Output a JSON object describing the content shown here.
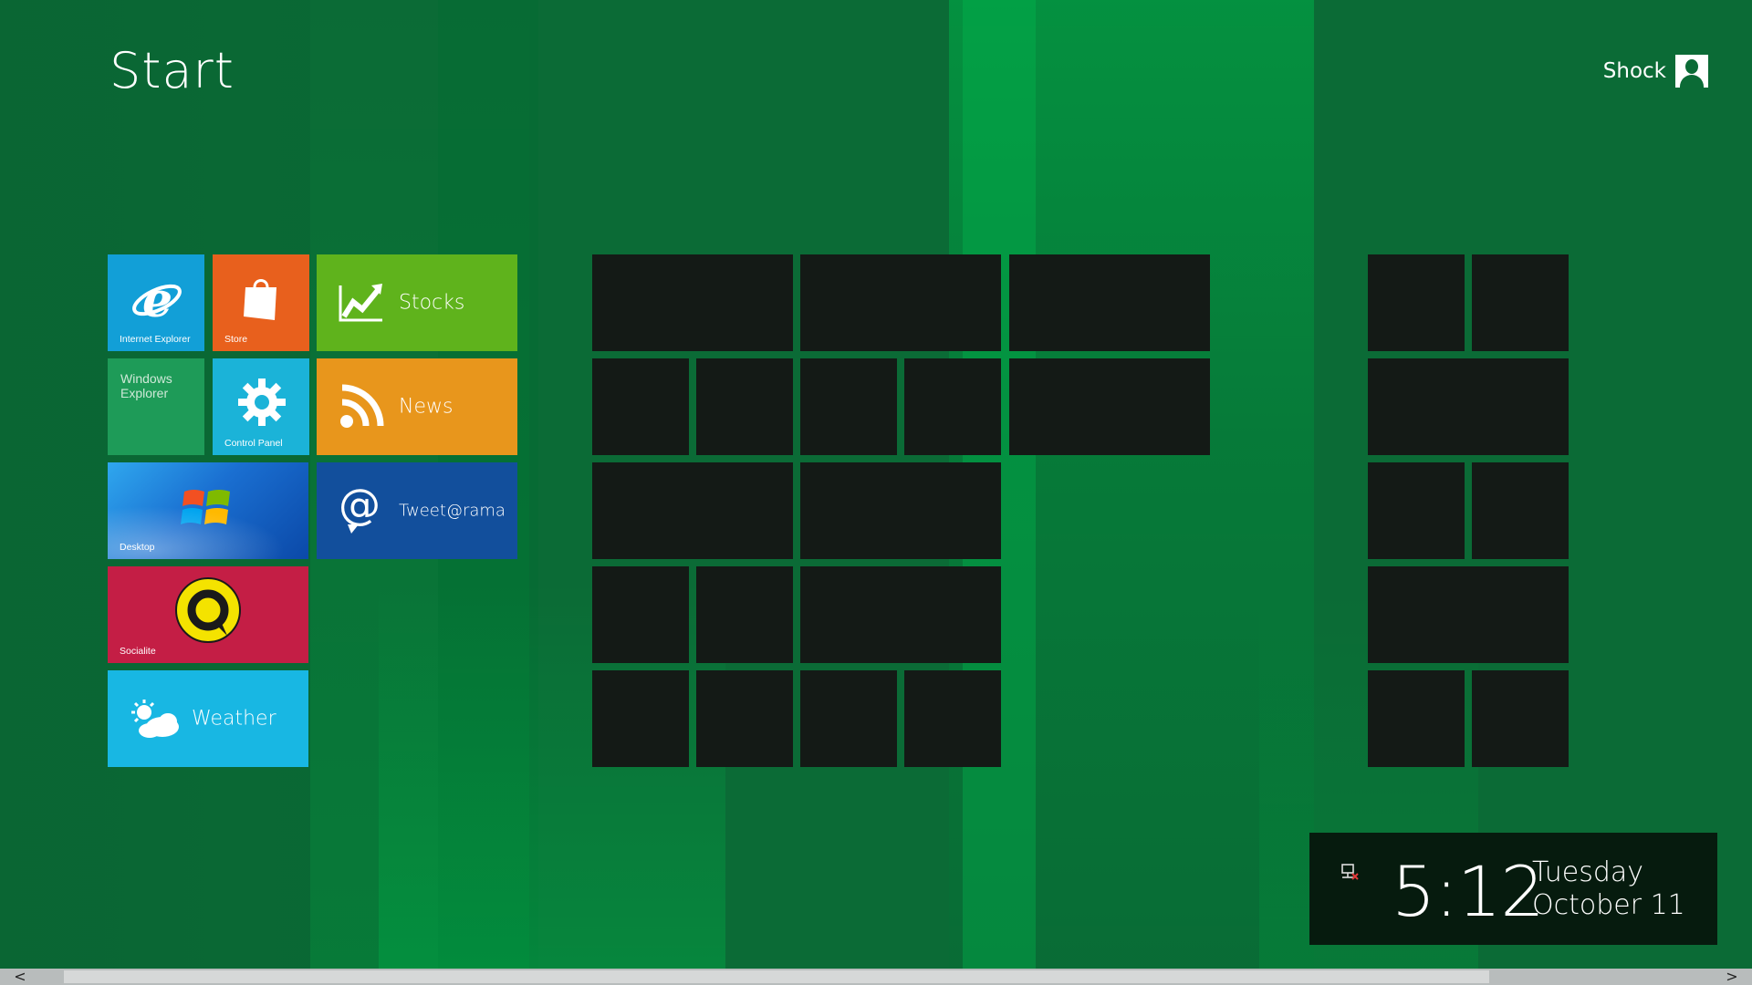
{
  "start_title": "Start",
  "user": {
    "name": "Shock"
  },
  "tiles": {
    "internet_explorer": {
      "label": "Internet Explorer",
      "color": "#129fd7"
    },
    "store": {
      "label": "Store",
      "color": "#e8601d"
    },
    "stocks": {
      "label": "Stocks",
      "color": "#5fb31c"
    },
    "windows_explorer": {
      "label": "Windows\nExplorer",
      "color": "#1e9b58"
    },
    "control_panel": {
      "label": "Control Panel",
      "color": "#1bb3d8"
    },
    "news": {
      "label": "News",
      "color": "#e8961c"
    },
    "desktop": {
      "label": "Desktop",
      "color": "#1f7ad3"
    },
    "tweetarama": {
      "label": "Tweet@rama",
      "color": "#124f9c"
    },
    "socialite": {
      "label": "Socialite",
      "color": "#c41e45"
    },
    "weather": {
      "label": "Weather",
      "color": "#18b7e3"
    }
  },
  "clock": {
    "time": "5:12",
    "day": "Tuesday",
    "date": "October 11"
  },
  "scrollbar": {
    "left_arrow": "<",
    "right_arrow": ">"
  }
}
